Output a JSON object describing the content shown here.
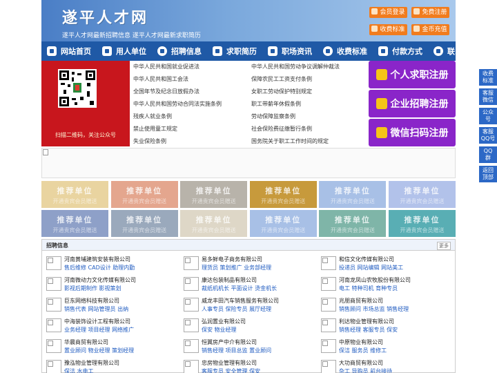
{
  "header": {
    "logo": "遂平人才网",
    "slogan": "遂平人才网最新招聘信息   遂平人才网最新求职简历",
    "buttons": [
      "会员登录",
      "免费注册",
      "收费标准",
      "金币充值"
    ]
  },
  "nav": [
    "网站首页",
    "用人单位",
    "招聘信息",
    "求职简历",
    "职场资讯",
    "收费标准",
    "付款方式",
    "联系客服"
  ],
  "qr": {
    "caption": "扫描二维码，关注公众号"
  },
  "laws": [
    "中华人民共和国就业促进法",
    "中华人民共和国劳动争议调解仲裁法",
    "中华人民共和国工会法",
    "保障农民工工资支付条例",
    "全国年节及纪念日放假办法",
    "女职工劳动保护特别规定",
    "中华人民共和国劳动合同法实施条例",
    "职工带薪年休假条例",
    "残疾人就业条例",
    "劳动保障监察条例",
    "禁止使用童工规定",
    "社会保险费征缴暂行条例",
    "失业保险条例",
    "国务院关于职工工作时间的规定"
  ],
  "register": [
    "个人求职注册",
    "企业招聘注册",
    "微信扫码注册"
  ],
  "recommend": {
    "title": "推荐单位",
    "subtitle": "开通贵宾会员赠送"
  },
  "recommend_colors": [
    "#e9d4a0",
    "#e4a68e",
    "#b8b3aa",
    "#c79a3c",
    "#a8c0e6",
    "#b2c2ea",
    "#8ea0c8",
    "#9aa9bc",
    "#ded7c7",
    "#a8c0e6",
    "#7fb5a8",
    "#59aeb4"
  ],
  "jobs": {
    "title": "招聘信息",
    "more": "更多",
    "companies": [
      {
        "name": "河南黄埔建筑安装有限公司",
        "positions": "售后维修 CAD设计 助理内勤"
      },
      {
        "name": "易多鲜电子商务有限公司",
        "positions": "理货员 策划推广 业务部经理"
      },
      {
        "name": "和信文化传媒有限公司",
        "positions": "投递员 网站编辑 网站美工"
      },
      {
        "name": "河南微动力文化传媒有限公司",
        "positions": "影视后期制作 影视策划"
      },
      {
        "name": "康达包装制品有限公司",
        "positions": "裁纸机机长 平面设计 烫金机长"
      },
      {
        "name": "河南龙凤山农牧股份有限公司",
        "positions": "电工 特种司机 育种专员"
      },
      {
        "name": "巨东网络科技有限公司",
        "positions": "销售代表 网站管理员 出纳"
      },
      {
        "name": "威龙丰田汽车销售服务有限公司",
        "positions": "人事专员 保险专员 展厅经理"
      },
      {
        "name": "兆朋商贸有限公司",
        "positions": "销售顾问 市场总监 销售经理"
      },
      {
        "name": "中海装饰设计工程有限公司",
        "positions": "业务经理 项目经理 网络推广"
      },
      {
        "name": "弘润置业有限公司",
        "positions": "保安 物业经理"
      },
      {
        "name": "利达物业管理有限公司",
        "positions": "销售经理 客服专员 保安"
      },
      {
        "name": "华晨商贸有限公司",
        "positions": "置业顾问 物业经理 策划经理"
      },
      {
        "name": "恒翼房产中介有限公司",
        "positions": "销售经理 项目总监 置业顾问"
      },
      {
        "name": "中原物业有限公司",
        "positions": "保洁 服务员 维修工"
      },
      {
        "name": "豫泓物业管理有限公司",
        "positions": "保洁 水电工"
      },
      {
        "name": "忠房物业管理有限公司",
        "positions": "客服专员 安全管理 保安"
      },
      {
        "name": "大功商贸有限公司",
        "positions": "杂工 导购员 前台接待"
      }
    ]
  },
  "sidebar": [
    "收费\n标准",
    "客服\n微信",
    "公众\n号",
    "客服\nQQ号",
    "QQ\n群",
    "返回\n顶部"
  ],
  "colors": {
    "nav": "#1f59a6",
    "accent": "#f17c1e",
    "register": "#8a25c9",
    "side": "#2c68c6"
  }
}
